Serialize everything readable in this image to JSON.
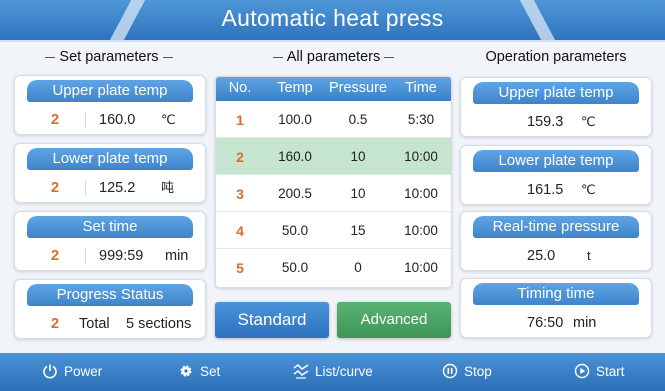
{
  "header": {
    "title": "Automatic heat press"
  },
  "sections": {
    "set": "Set parameters",
    "all": "All parameters",
    "operation": "Operation parameters"
  },
  "set_params": [
    {
      "label": "Upper plate temp",
      "index": "2",
      "value": "160.0",
      "unit": "℃"
    },
    {
      "label": "Lower plate temp",
      "index": "2",
      "value": "125.2",
      "unit": "吨"
    },
    {
      "label": "Set time",
      "index": "2",
      "value": "999:59",
      "unit": "min"
    },
    {
      "label": "Progress Status",
      "index": "2",
      "value": "Total",
      "unit": "5 sections"
    }
  ],
  "table": {
    "headers": [
      "No.",
      "Temp",
      "Pressure",
      "Time"
    ],
    "rows": [
      {
        "no": "1",
        "temp": "100.0",
        "pressure": "0.5",
        "time": "5:30"
      },
      {
        "no": "2",
        "temp": "160.0",
        "pressure": "10",
        "time": "10:00"
      },
      {
        "no": "3",
        "temp": "200.5",
        "pressure": "10",
        "time": "10:00"
      },
      {
        "no": "4",
        "temp": "50.0",
        "pressure": "15",
        "time": "10:00"
      },
      {
        "no": "5",
        "temp": "50.0",
        "pressure": "0",
        "time": "10:00"
      }
    ],
    "selected_row": 2
  },
  "buttons": {
    "standard": "Standard",
    "advanced": "Advanced"
  },
  "operation_params": [
    {
      "label": "Upper plate temp",
      "value": "159.3",
      "unit": "℃"
    },
    {
      "label": "Lower plate temp",
      "value": "161.5",
      "unit": "℃"
    },
    {
      "label": "Real-time pressure",
      "value": "25.0",
      "unit": "t"
    },
    {
      "label": "Timing time",
      "value": "76:50",
      "unit": "min"
    }
  ],
  "footer": [
    {
      "label": "Power",
      "icon": "power-icon"
    },
    {
      "label": "Set",
      "icon": "gear-icon"
    },
    {
      "label": "List/curve",
      "icon": "curve-icon"
    },
    {
      "label": "Stop",
      "icon": "pause-icon"
    },
    {
      "label": "Start",
      "icon": "play-icon"
    }
  ],
  "colors": {
    "primary_blue": "#3d84cb",
    "index_orange": "#e06a2a",
    "selected_row_green": "#c5e5cf",
    "advanced_green": "#4aa365"
  }
}
